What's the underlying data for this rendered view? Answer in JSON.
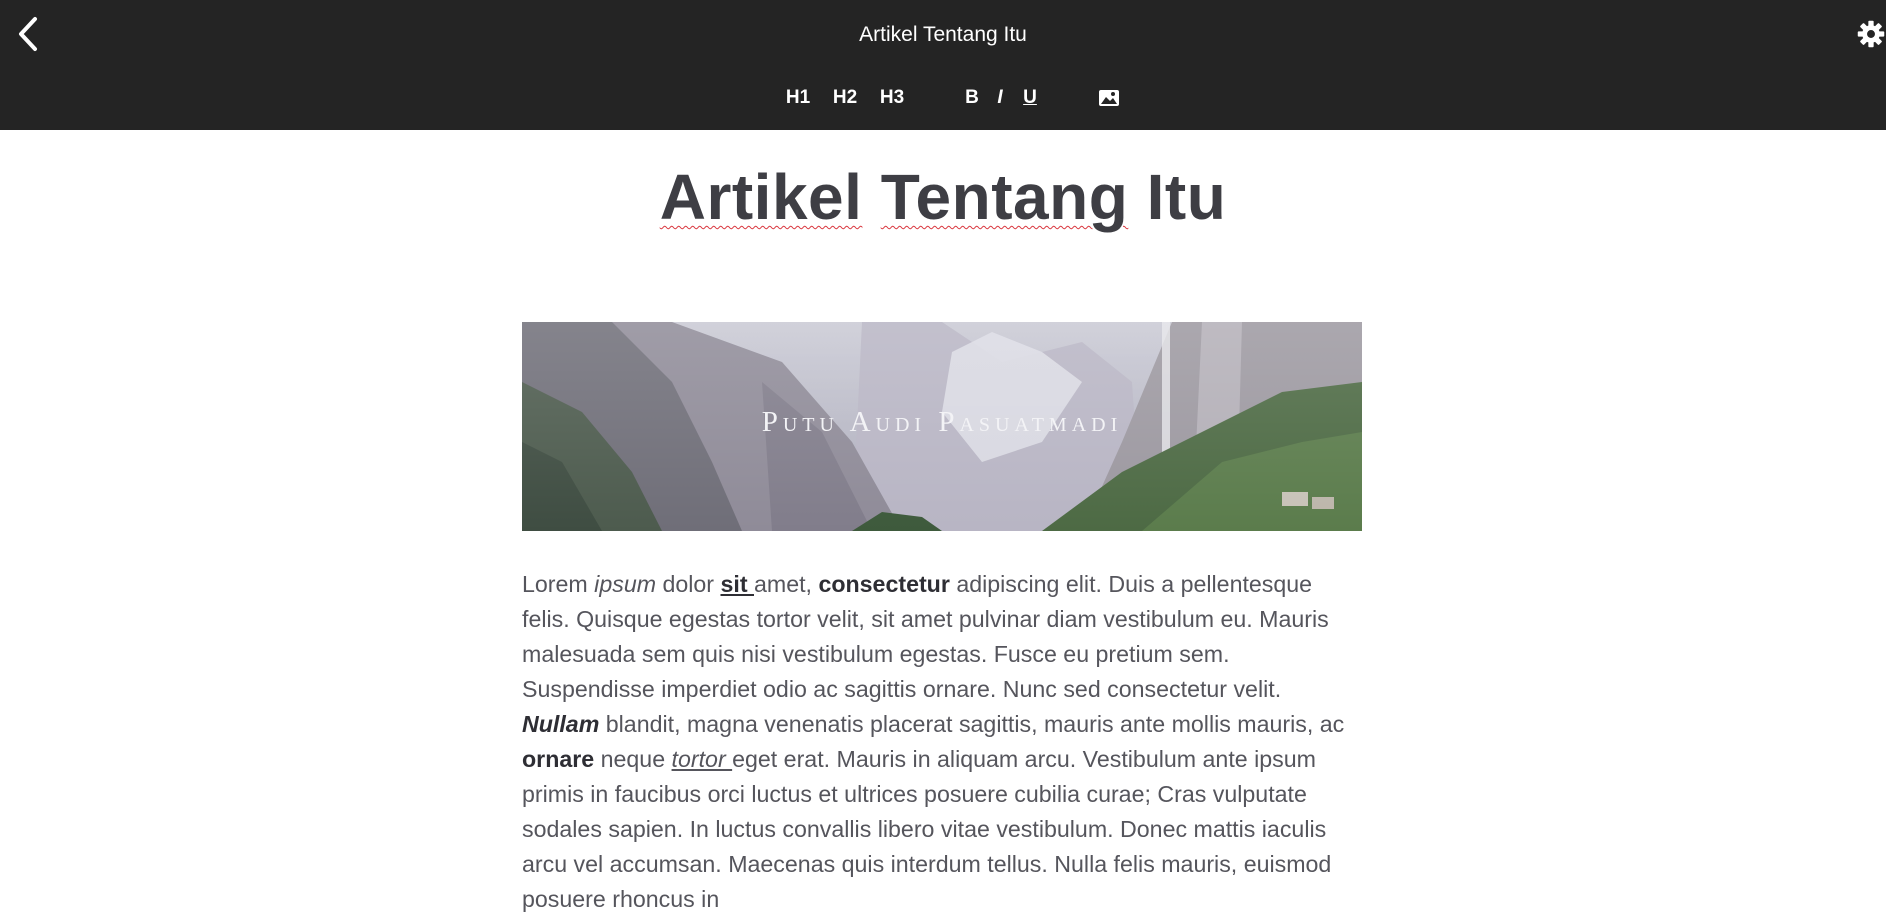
{
  "header": {
    "title": "Artikel Tentang Itu",
    "back_icon": "chevron-left-icon",
    "settings_icon": "gear-icon"
  },
  "toolbar": {
    "h1": "H1",
    "h2": "H2",
    "h3": "H3",
    "bold": "B",
    "italic": "I",
    "underline": "U",
    "image_icon": "image-icon"
  },
  "article": {
    "heading_word1": "Artikel",
    "heading_word2": "Tentang",
    "heading_word3": "Itu",
    "banner_text": "Putu Audi Pasuatmadi",
    "body": {
      "t1": "Lorem ",
      "t2": "ipsum",
      "t3": " dolor ",
      "t4": "sit ",
      "t5": "amet, ",
      "t6": "consectetur",
      "t7": " adipiscing elit. Duis a pellentesque felis. Quisque egestas tortor velit, sit amet pulvinar diam vestibulum eu. Mauris malesuada sem quis nisi vestibulum egestas. Fusce eu pretium sem. Suspendisse imperdiet odio ac sagittis ornare. Nunc sed consectetur velit. ",
      "t8": "Nullam",
      "t9": " blandit, magna venenatis placerat sagittis, mauris ante mollis mauris, ac ",
      "t10": "ornare",
      "t11": " neque ",
      "t12": "tortor ",
      "t13": "eget erat. Mauris in aliquam arcu. Vestibulum ante ipsum primis in faucibus orci luctus et ultrices posuere cubilia curae; Cras vulputate sodales sapien. In luctus convallis libero vitae vestibulum. Donec mattis iaculis arcu vel accumsan. Maecenas quis interdum tellus. Nulla felis mauris, euismod posuere rhoncus in"
    }
  },
  "colors": {
    "topbar_bg": "#242424",
    "heading": "#3e3e44",
    "body_text": "#55555c",
    "spellcheck": "#d9363e"
  }
}
